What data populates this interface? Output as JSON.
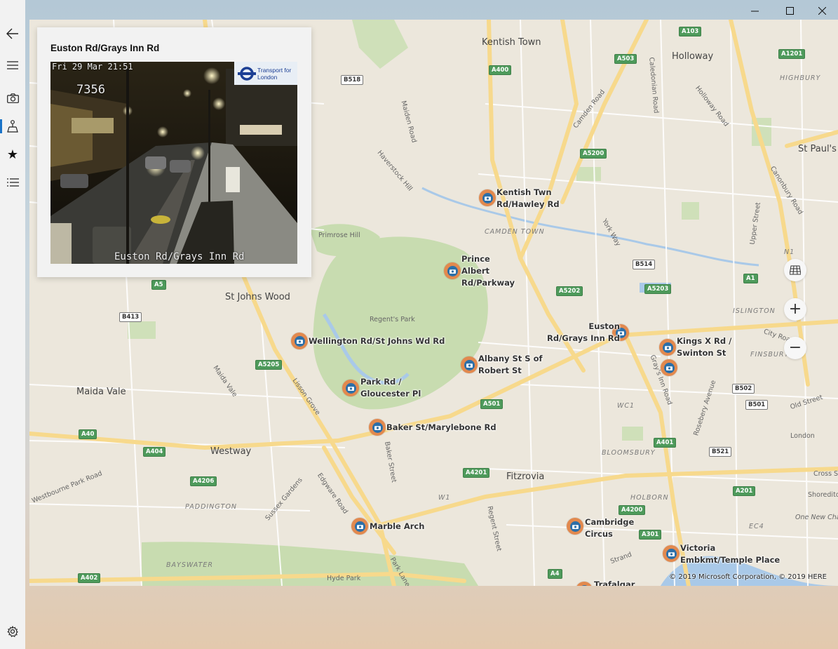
{
  "window": {
    "controls": {
      "minimize": "—",
      "maximize": "☐",
      "close": "✕"
    }
  },
  "nav": {
    "items": [
      {
        "name": "back",
        "icon": "back-arrow-icon",
        "glyph": "←"
      },
      {
        "name": "menu",
        "icon": "hamburger-icon",
        "glyph": "≡"
      },
      {
        "name": "cameras",
        "icon": "camera-icon",
        "glyph": ""
      },
      {
        "name": "map",
        "icon": "map-person-icon",
        "glyph": ""
      },
      {
        "name": "favorites",
        "icon": "star-icon",
        "glyph": "★"
      },
      {
        "name": "list",
        "icon": "list-icon",
        "glyph": ""
      }
    ],
    "settings_icon": "gear-icon"
  },
  "selected_camera": {
    "title": "Euston Rd/Grays Inn Rd",
    "overlay_timestamp": "Fri 29 Mar 21:51",
    "overlay_id": "7356",
    "overlay_brand": "Transport for London",
    "overlay_caption": "Euston Rd/Grays Inn Rd"
  },
  "map": {
    "places": [
      "Kentish Town",
      "Holloway",
      "St Paul's",
      "St Johns Wood",
      "Maida Vale",
      "Westway",
      "Fitzrovia",
      "London"
    ],
    "districts": [
      "CAMDEN TOWN",
      "ISLINGTON",
      "FINSBURY",
      "BLOOMSBURY",
      "PADDINGTON",
      "BAYSWATER",
      "HOLBORN",
      "WC1",
      "W1",
      "EC4",
      "HIGHBURY",
      "N1"
    ],
    "streets": [
      "Camden Road",
      "Holloway Road",
      "Caledonian Road",
      "Maiden Road",
      "Haverstock Hill",
      "Primrose Hill",
      "Regent's Park",
      "Upper Street",
      "York Way",
      "City Road",
      "Maida Vale",
      "Edgware Road",
      "Baker Street",
      "Lisson Grove",
      "Sussex Gardens",
      "Westbourne Park Road",
      "Regent Street",
      "Gray's Inn Road",
      "Rosebery Avenue",
      "Old Street",
      "Strand",
      "Hyde Park",
      "Park Lane",
      "Canonbury Road",
      "Cross Street",
      "Shoreditch",
      "One New Change"
    ],
    "road_badges": [
      "A103",
      "A1201",
      "A503",
      "A400",
      "B518",
      "A5200",
      "A5202",
      "B514",
      "A5203",
      "A1",
      "A5",
      "B413",
      "A5205",
      "A501",
      "A40",
      "A404",
      "A4206",
      "A4201",
      "A401",
      "B502",
      "B501",
      "B521",
      "A4200",
      "A301",
      "A402",
      "A4",
      "A201"
    ],
    "camera_pins": [
      {
        "label": "Kentish Twn\nRd/Hawley Rd"
      },
      {
        "label": "Prince\nAlbert\nRd/Parkway"
      },
      {
        "label": "Euston\nRd/Grays Inn Rd"
      },
      {
        "label": "Kings X Rd /\nSwinton St"
      },
      {
        "label": ""
      },
      {
        "label": "Wellington Rd/St Johns Wd Rd"
      },
      {
        "label": "Albany St S of\nRobert St"
      },
      {
        "label": "Park Rd /\nGloucester Pl"
      },
      {
        "label": "Baker St/Marylebone Rd"
      },
      {
        "label": "Marble Arch"
      },
      {
        "label": "Cambridge\nCircus"
      },
      {
        "label": "Victoria\nEmbkmt/Temple Place"
      },
      {
        "label": "Trafalgar"
      }
    ],
    "controls": {
      "layers_icon": "map-layers-icon",
      "zoom_in": "+",
      "zoom_out": "−"
    },
    "copyright": "© 2019 Microsoft Corporation, © 2019 HERE"
  },
  "colors": {
    "accent": "#1a73c8",
    "pin_ring": "#e2894e",
    "pin_core": "#2c6fa8",
    "park": "#c8dcb0",
    "water": "#a9c9e8",
    "major_road": "#f7d98c"
  }
}
